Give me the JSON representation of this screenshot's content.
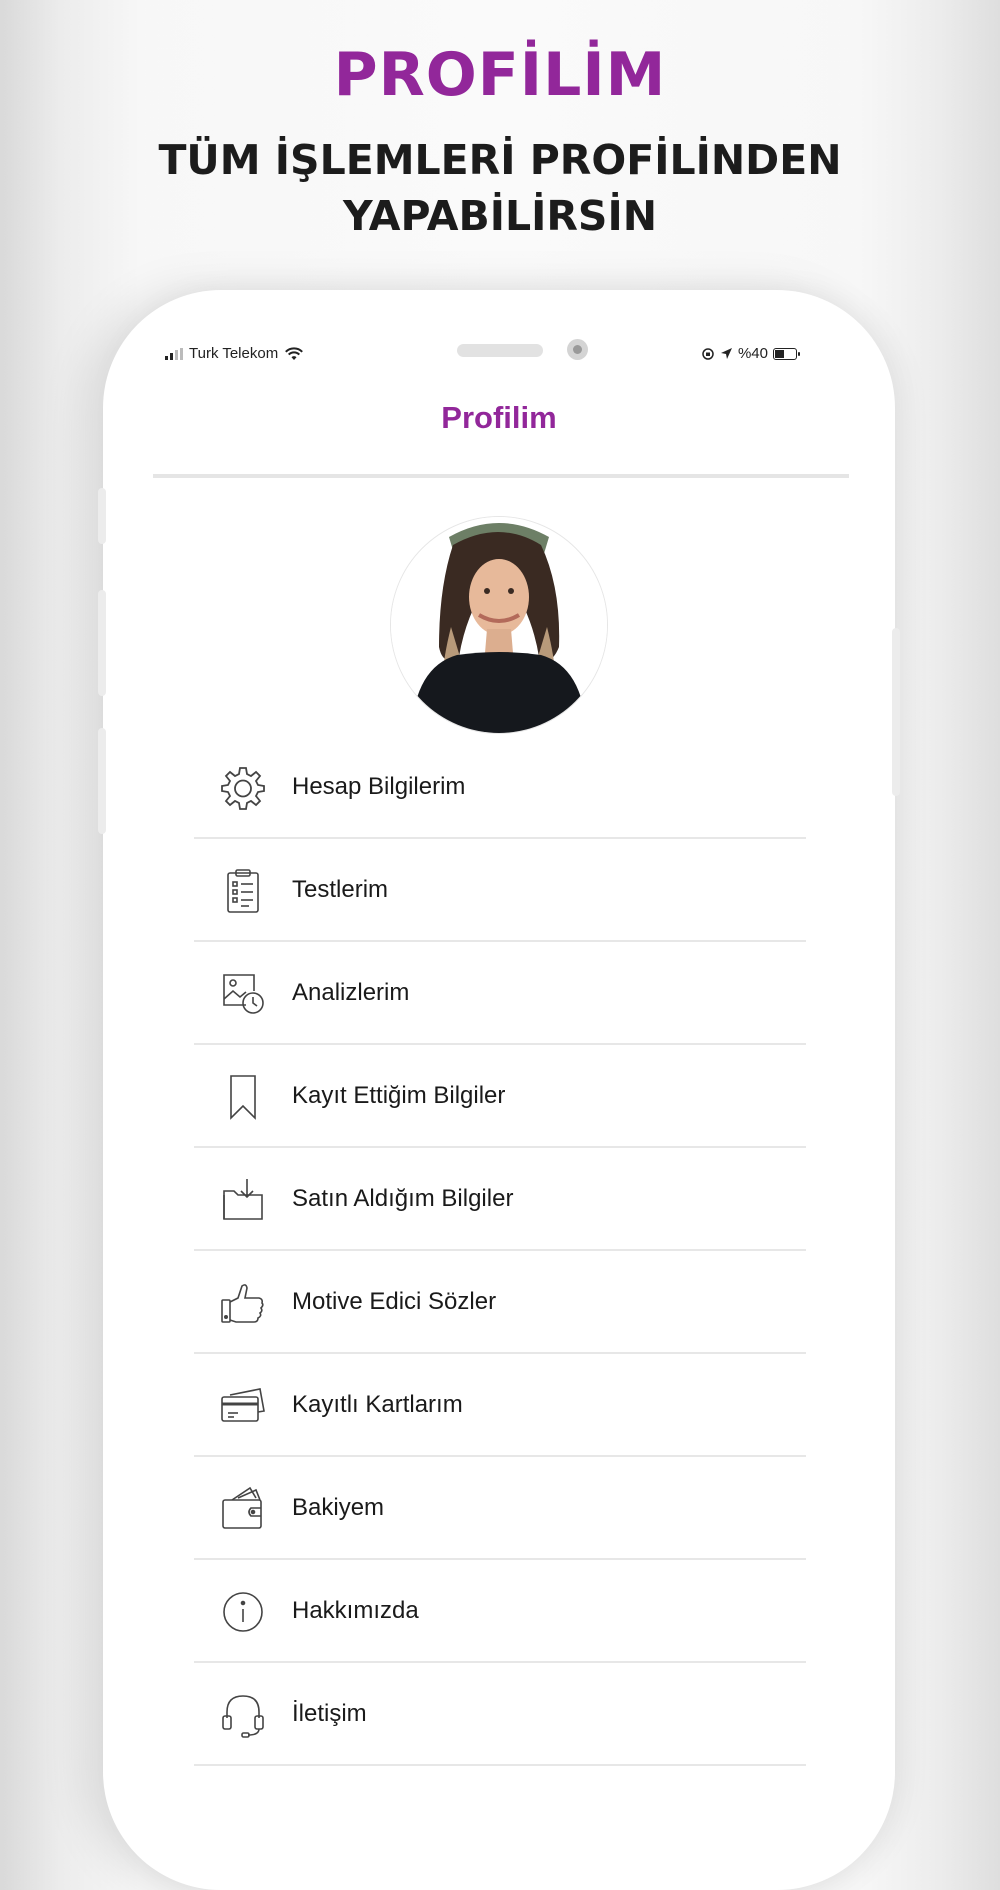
{
  "banner": {
    "title": "PROFİLİM",
    "subtitle_line1": "TÜM İŞLEMLERİ PROFİLİNDEN",
    "subtitle_line2": "YAPABİLİRSİN"
  },
  "status_bar": {
    "carrier": "Turk Telekom",
    "battery": "%40"
  },
  "nav": {
    "title": "Profilim"
  },
  "colors": {
    "accent": "#92279a",
    "text": "#1a1a1a",
    "divider": "#e7e7e7"
  },
  "menu": [
    {
      "label": "Hesap Bilgilerim",
      "icon": "gear-icon"
    },
    {
      "label": "Testlerim",
      "icon": "clipboard-checklist-icon"
    },
    {
      "label": "Analizlerim",
      "icon": "image-clock-icon"
    },
    {
      "label": "Kayıt Ettiğim Bilgiler",
      "icon": "bookmark-icon"
    },
    {
      "label": "Satın Aldığım Bilgiler",
      "icon": "download-folder-icon"
    },
    {
      "label": "Motive Edici Sözler",
      "icon": "thumbs-up-icon"
    },
    {
      "label": "Kayıtlı Kartlarım",
      "icon": "credit-cards-icon"
    },
    {
      "label": "Bakiyem",
      "icon": "wallet-icon"
    },
    {
      "label": "Hakkımızda",
      "icon": "info-icon"
    },
    {
      "label": "İletişim",
      "icon": "headset-icon"
    }
  ]
}
